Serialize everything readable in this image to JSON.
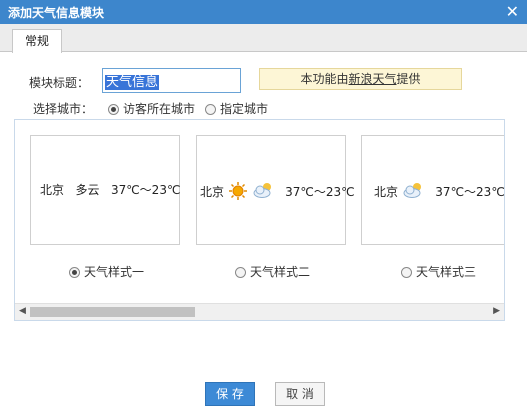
{
  "dialog": {
    "title": "添加天气信息模块",
    "close_glyph": "✕"
  },
  "tabs": [
    {
      "label": "常规"
    }
  ],
  "form": {
    "title_label": "模块标题：",
    "title_value": "天气信息",
    "notice_prefix": "本功能由",
    "notice_link": "新浪天气",
    "notice_suffix": "提供",
    "city_label": "选择城市：",
    "city_options": [
      {
        "label": "访客所在城市",
        "checked": true
      },
      {
        "label": "指定城市",
        "checked": false
      }
    ]
  },
  "styles": [
    {
      "city": "北京",
      "desc": "多云",
      "temp": "37℃～23℃",
      "option": "天气样式一",
      "checked": true,
      "icons": []
    },
    {
      "city": "北京",
      "desc": "",
      "temp": "37℃～23℃",
      "option": "天气样式二",
      "checked": false,
      "icons": [
        "sun-icon",
        "cloud-icon"
      ]
    },
    {
      "city": "北京",
      "desc": "",
      "temp": "37℃～23℃",
      "option": "天气样式三",
      "checked": false,
      "icons": [
        "cloud-icon"
      ]
    }
  ],
  "buttons": {
    "save": "保 存",
    "cancel": "取 消"
  },
  "colors": {
    "titlebar": "#3d86cc",
    "save_button": "#3d8ad6",
    "notice_bg": "#fdf6d6"
  }
}
